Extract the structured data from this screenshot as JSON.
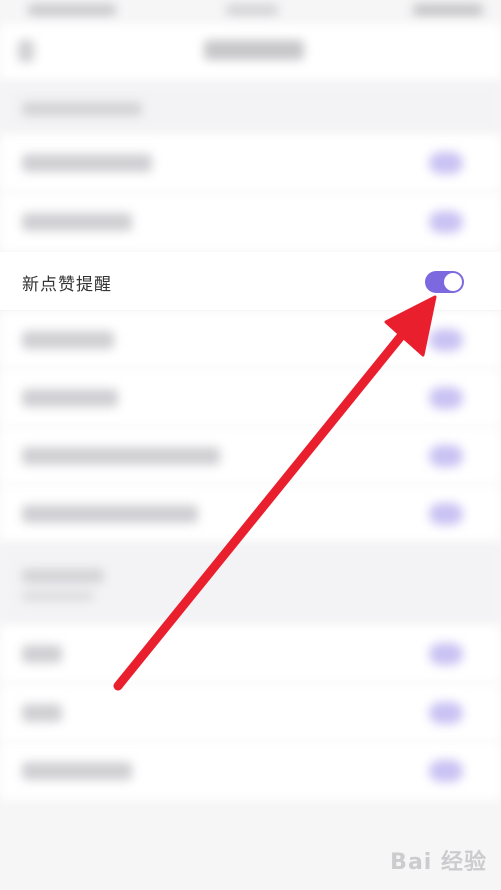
{
  "settings": {
    "focused_row": {
      "label": "新点赞提醒",
      "toggle_on": true
    }
  },
  "watermark": {
    "text": "Bai 经验"
  },
  "colors": {
    "toggle_on": "#7c69e0",
    "arrow": "#ea1f2e",
    "page_bg": "#f6f6f7",
    "row_bg": "#ffffff"
  }
}
